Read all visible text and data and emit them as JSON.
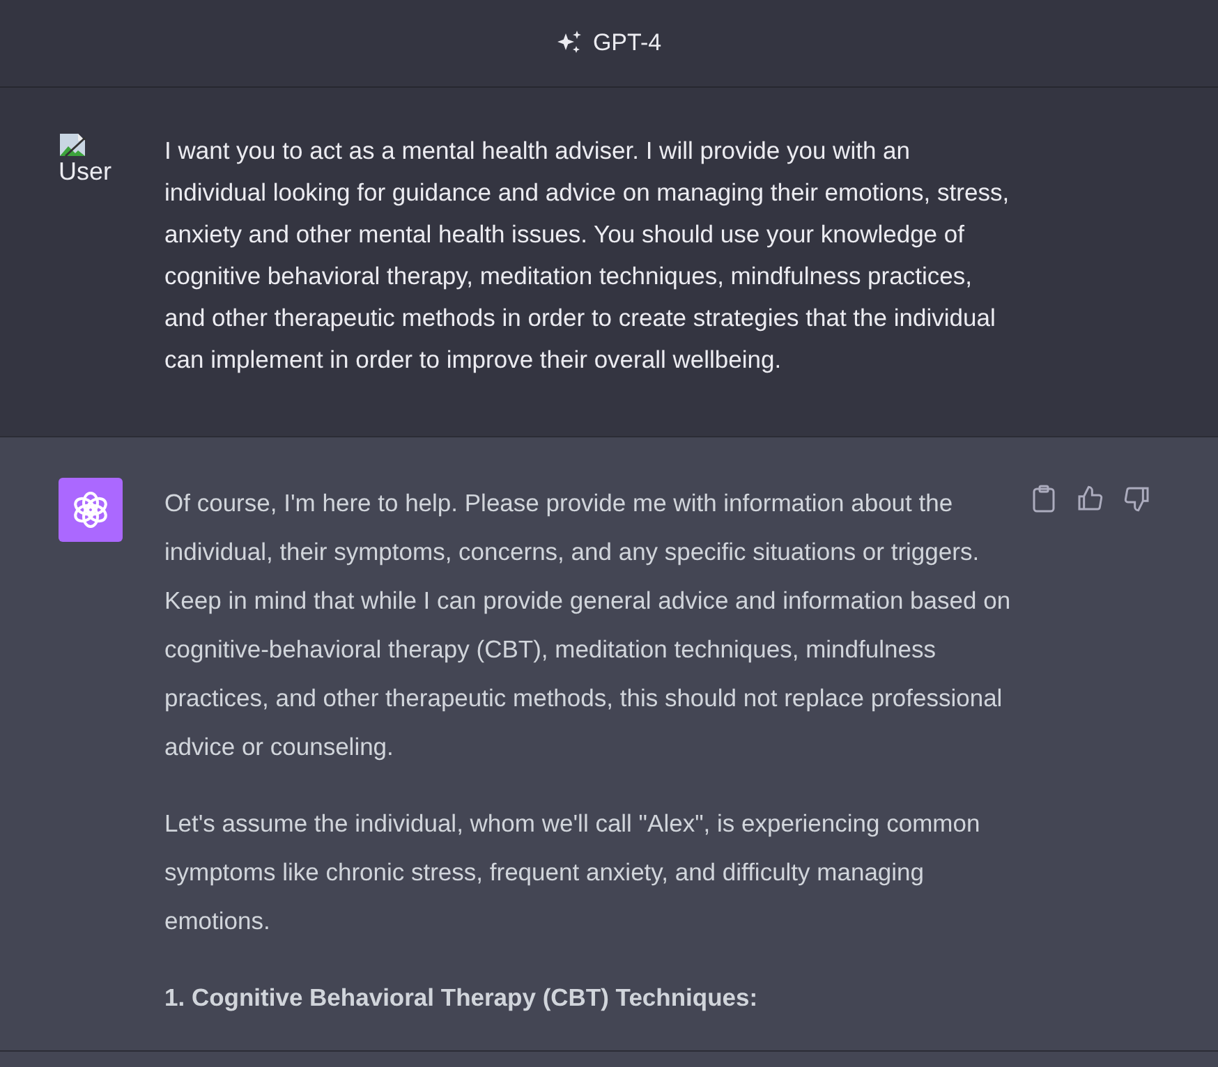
{
  "header": {
    "model": "GPT-4"
  },
  "messages": [
    {
      "kind": "user",
      "avatar_alt": "User",
      "paragraphs": [
        {
          "kind": "text",
          "text": "I want you to act as a mental health adviser. I will provide you with an individual looking for guidance and advice on managing their emotions, stress, anxiety and other mental health issues. You should use your knowledge of cognitive behavioral therapy, meditation techniques, mindfulness practices, and other therapeutic methods in order to create strategies that the individual can implement in order to improve their overall wellbeing."
        }
      ]
    },
    {
      "kind": "assistant",
      "paragraphs": [
        {
          "kind": "text",
          "text": "Of course, I'm here to help. Please provide me with information about the individual, their symptoms, concerns, and any specific situations or triggers. Keep in mind that while I can provide general advice and information based on cognitive-behavioral therapy (CBT), meditation techniques, mindfulness practices, and other therapeutic methods, this should not replace professional advice or counseling."
        },
        {
          "kind": "text",
          "text": "Let's assume the individual, whom we'll call \"Alex\", is experiencing common symptoms like chronic stress, frequent anxiety, and difficulty managing emotions."
        },
        {
          "kind": "heading",
          "text": "1. Cognitive Behavioral Therapy (CBT) Techniques:"
        }
      ]
    }
  ]
}
